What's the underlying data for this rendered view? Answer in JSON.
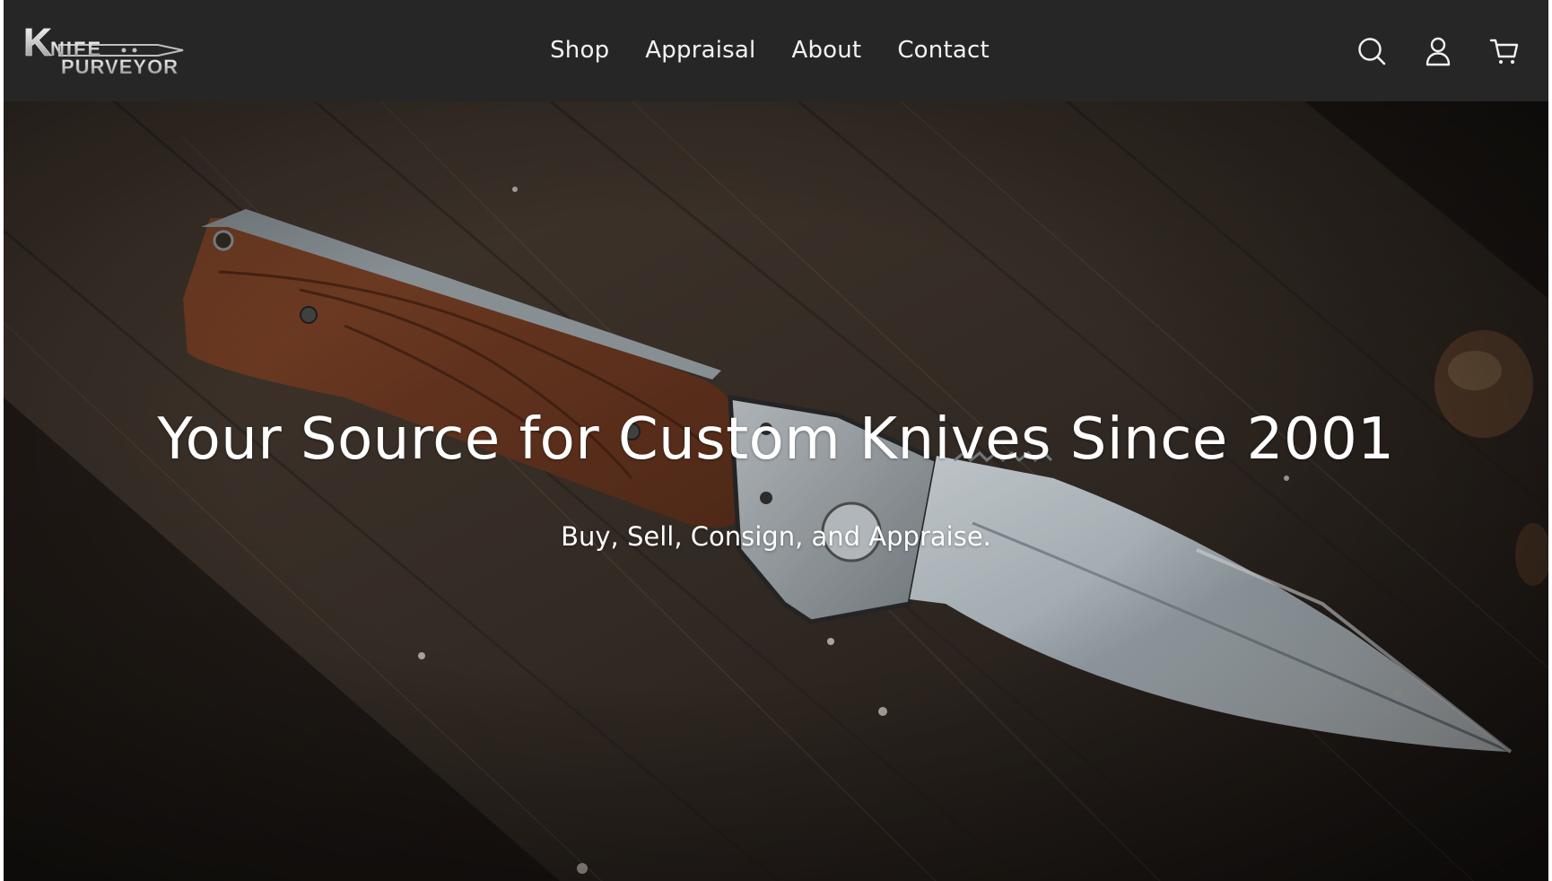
{
  "brand": {
    "logo_line1": "KNIFE",
    "logo_line2": "PURVEYOR"
  },
  "nav": {
    "items": [
      {
        "label": "Shop"
      },
      {
        "label": "Appraisal"
      },
      {
        "label": "About"
      },
      {
        "label": "Contact"
      }
    ]
  },
  "header_icons": [
    "search-icon",
    "account-icon",
    "cart-icon"
  ],
  "hero": {
    "title": "Your Source for Custom Knives Since 2001",
    "subtitle": "Buy, Sell, Consign, and Appraise."
  },
  "colors": {
    "header_bg": "#262626",
    "nav_text": "#f2f2f2",
    "hero_text": "#ffffff"
  }
}
